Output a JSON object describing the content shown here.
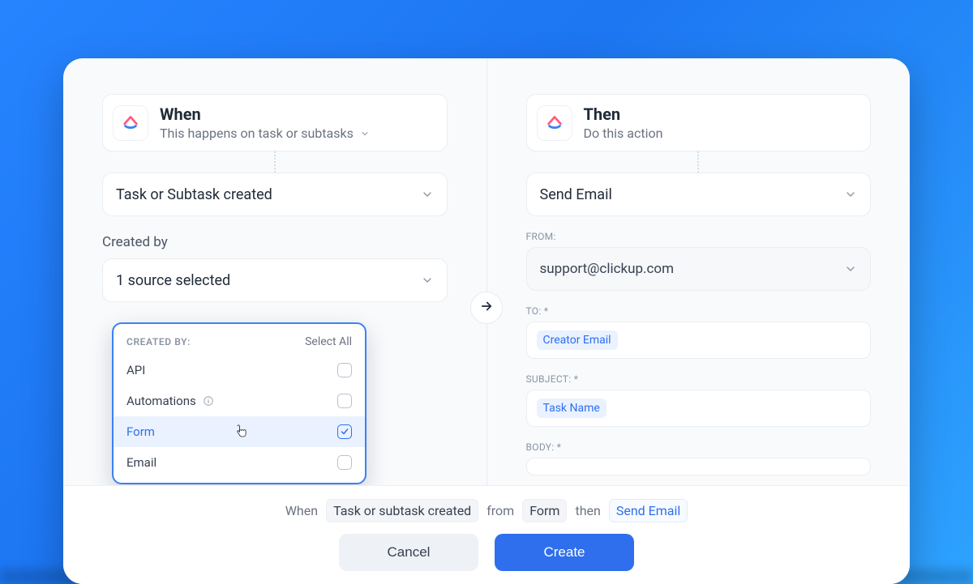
{
  "when": {
    "title": "When",
    "subtitle": "This happens on task or subtasks",
    "trigger_label": "Task or Subtask created",
    "created_by_label": "Created by",
    "sources_selected_count": 1,
    "sources_selected_label": "1 source selected"
  },
  "created_by_popover": {
    "header": "CREATED BY:",
    "select_all": "Select All",
    "options": [
      {
        "label": "API",
        "selected": false,
        "hover": false,
        "info": false
      },
      {
        "label": "Automations",
        "selected": false,
        "hover": false,
        "info": true
      },
      {
        "label": "Form",
        "selected": true,
        "hover": true,
        "info": false
      },
      {
        "label": "Email",
        "selected": false,
        "hover": false,
        "info": false
      }
    ]
  },
  "then": {
    "title": "Then",
    "subtitle": "Do this action",
    "action_label": "Send Email",
    "from_label": "FROM:",
    "from_value": "support@clickup.com",
    "to_label": "TO: *",
    "to_chip": "Creator Email",
    "subject_label": "SUBJECT: *",
    "subject_chip": "Task Name",
    "body_label": "BODY: *"
  },
  "footer": {
    "sentence": {
      "when": "When",
      "trigger": "Task or subtask created",
      "from": "from",
      "source": "Form",
      "then": "then",
      "action": "Send Email"
    },
    "cancel": "Cancel",
    "create": "Create"
  }
}
